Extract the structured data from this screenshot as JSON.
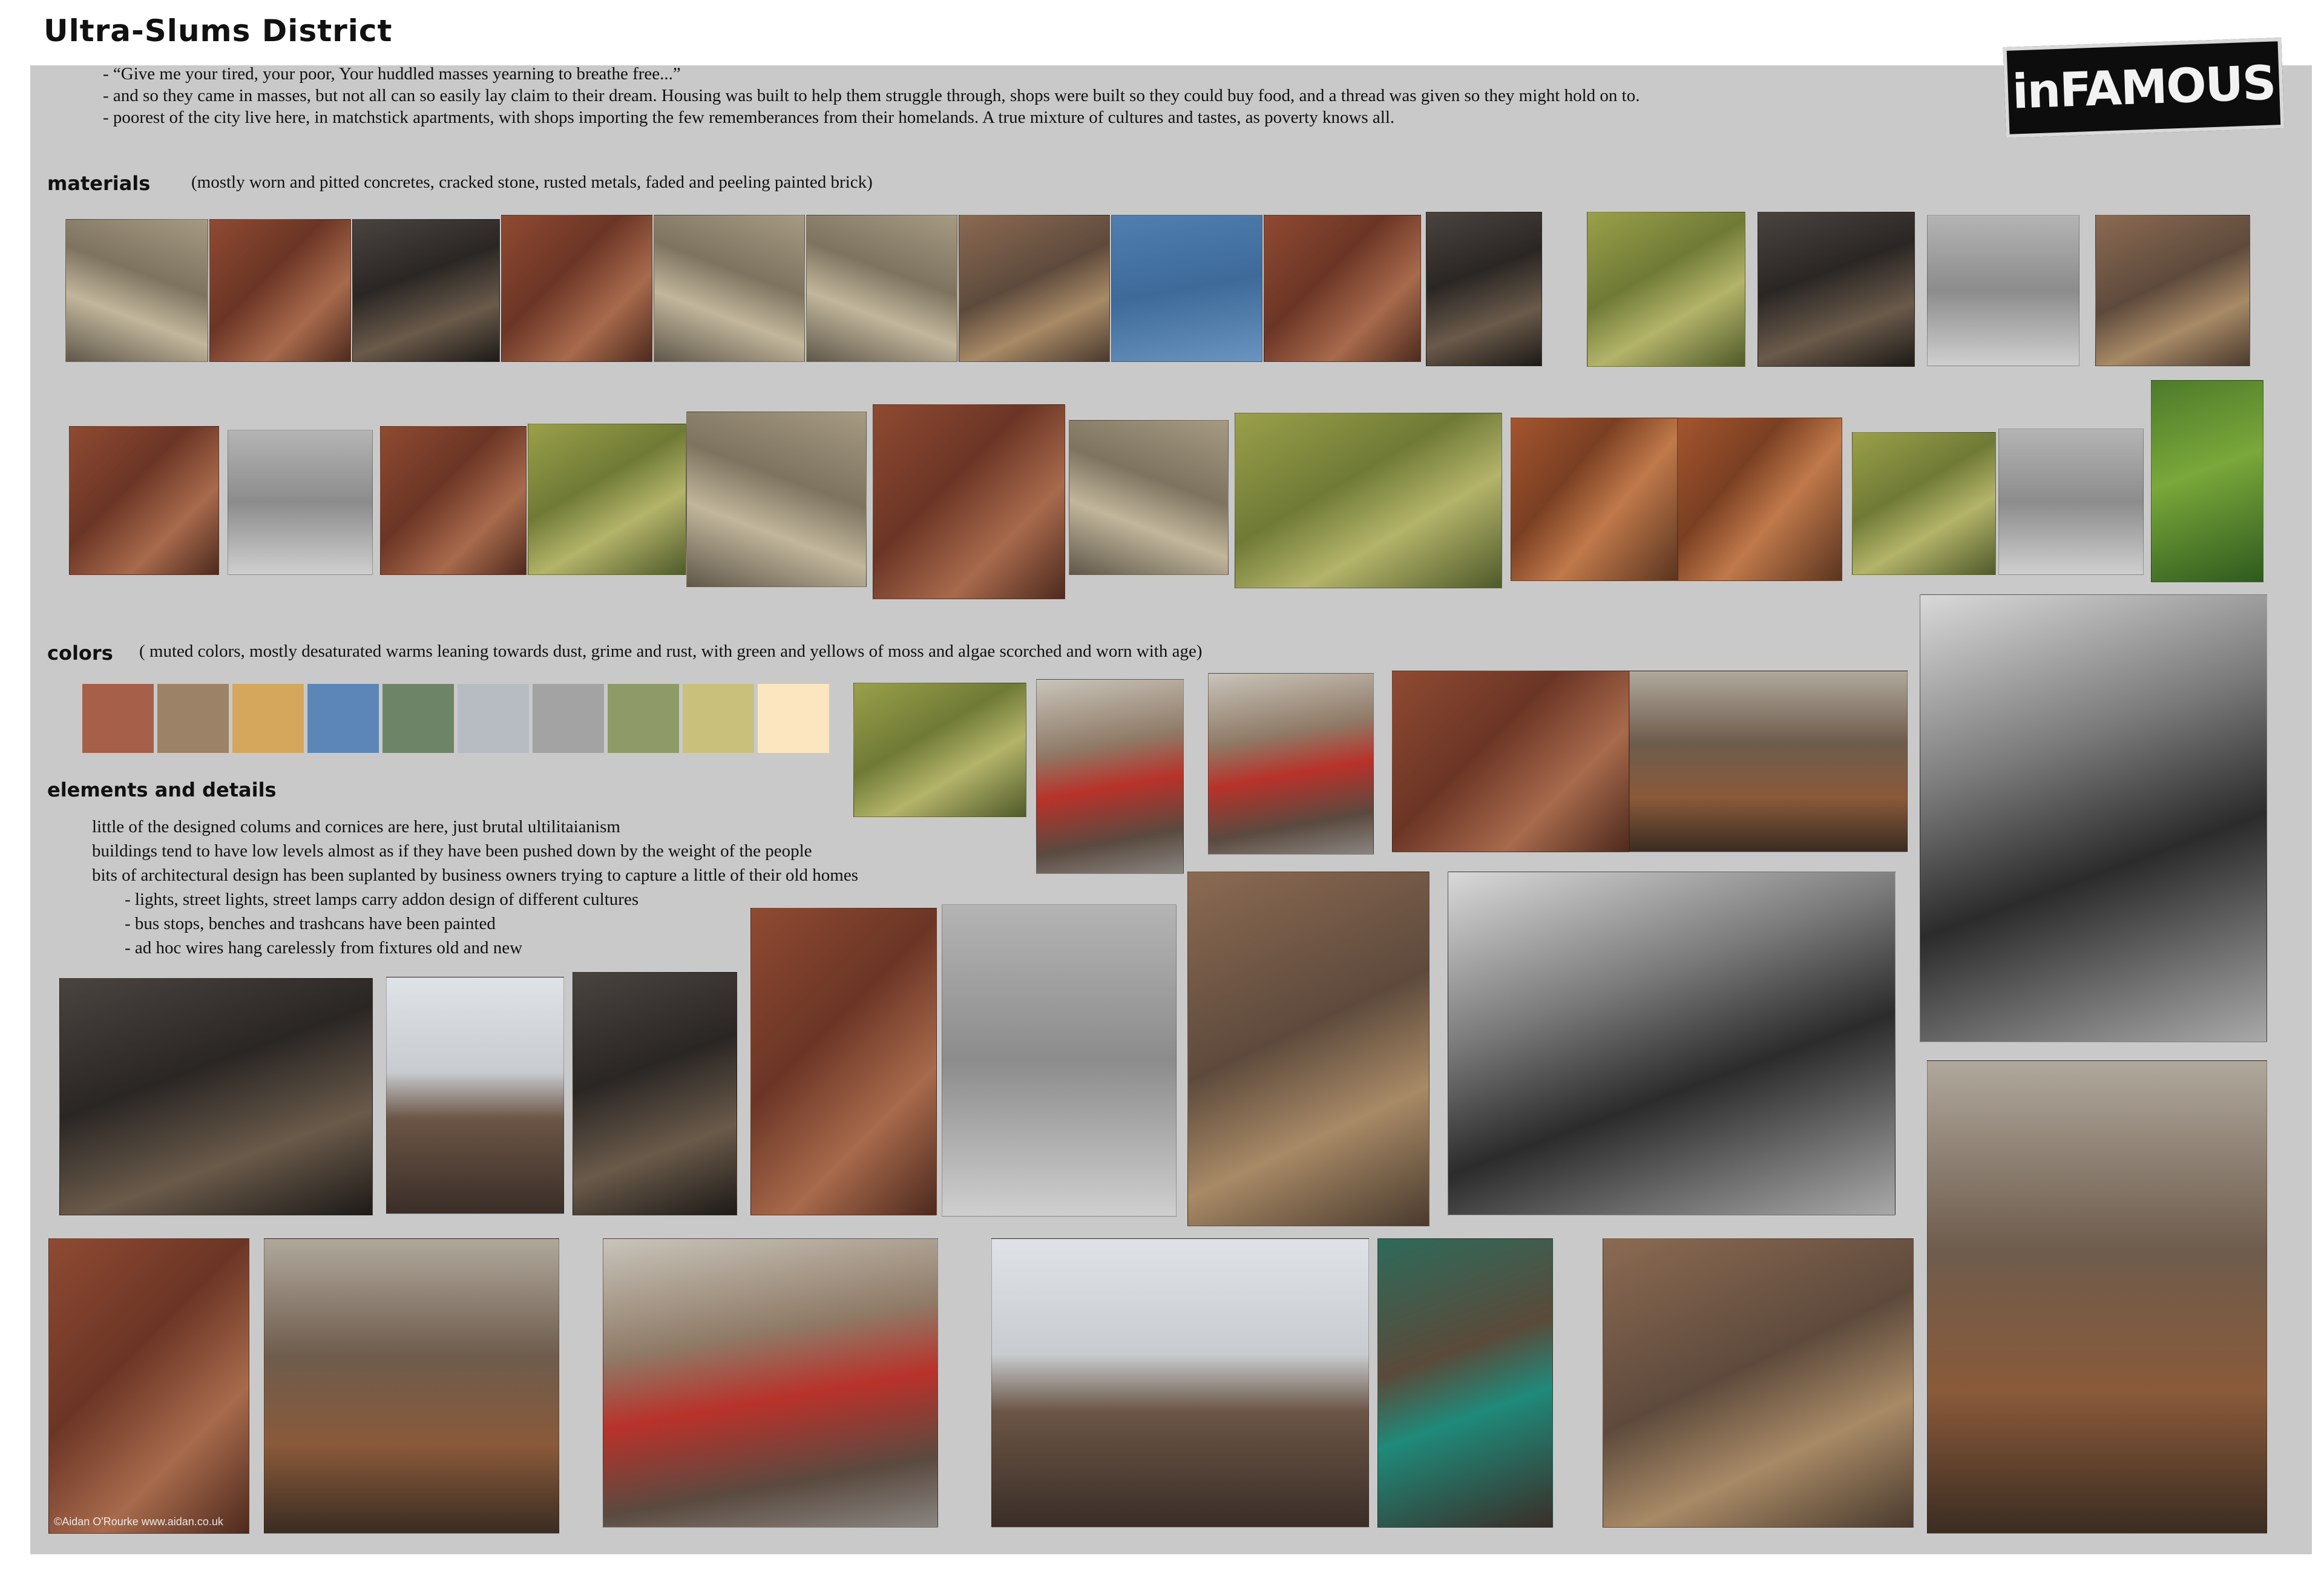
{
  "title": "Ultra-Slums District",
  "logo_text": "inFAMOUS",
  "intro": [
    "-  “Give me your tired, your poor,  Your huddled masses yearning to breathe free...”",
    "-  and so they came in masses, but not all can so easily lay claim to their dream.  Housing was built to help them struggle through, shops were built so they could buy food, and a thread was given so they might hold on to.",
    "-  poorest of the city live here, in matchstick apartments, with shops importing the few rememberances from their homelands.  A true mixture of cultures and tastes, as poverty knows all."
  ],
  "materials": {
    "heading": "materials",
    "note": "(mostly worn and pitted concretes, cracked stone,  rusted metals, faded and peeling painted brick)"
  },
  "colors": {
    "heading": "colors",
    "note": "( muted colors, mostly desaturated warms leaning towards dust, grime and rust, with green and yellows of moss and algae scorched and worn with age)",
    "swatches": [
      "#a65f48",
      "#9c8266",
      "#d4a75c",
      "#5b86b7",
      "#6e8467",
      "#b7bcc2",
      "#a3a3a3",
      "#8e9a67",
      "#c9c17b",
      "#fbe6bf"
    ]
  },
  "elements": {
    "heading": "elements and details",
    "lines": [
      "little of the designed colums and cornices are here, just brutal ultilitaianism",
      "buildings tend to have low levels almost as if they have been pushed down by the weight of the people",
      "bits of architectural design has been suplanted by business owners trying to capture a little of their old homes"
    ],
    "sublines": [
      "-  lights, street lights, street lamps carry addon design of different cultures",
      "-  bus stops, benches and trashcans have been painted",
      "-  ad hoc wires hang carelessly from fixtures old and new"
    ]
  },
  "photo_caption": "©Aidan O'Rourke www.aidan.co.uk"
}
